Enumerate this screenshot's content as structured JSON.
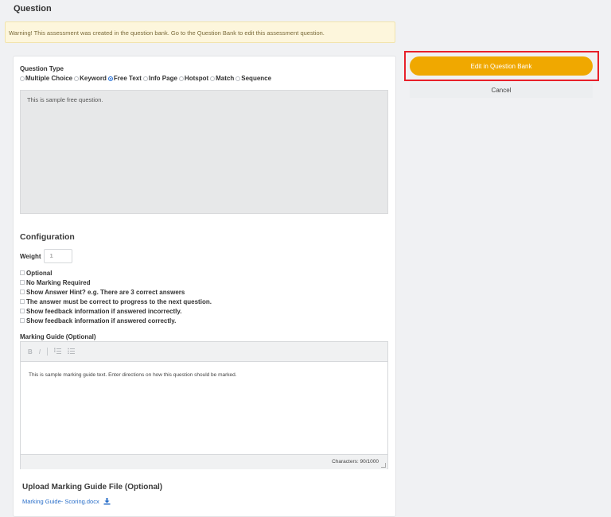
{
  "page": {
    "title": "Question"
  },
  "warning": {
    "text": "Warning! This assessment was created in the question bank. Go to the Question Bank to edit this assessment question."
  },
  "question_type": {
    "label": "Question Type",
    "options": [
      "Multiple Choice",
      "Keyword",
      "Free Text",
      "Info Page",
      "Hotspot",
      "Match",
      "Sequence"
    ],
    "selected": "Free Text"
  },
  "question_text": "This is sample free question.",
  "configuration": {
    "title": "Configuration",
    "weight_label": "Weight",
    "weight_value": "1",
    "checkboxes": [
      "Optional",
      "No Marking Required",
      "Show Answer Hint? e.g. There are 3 correct answers",
      "The answer must be correct to progress to the next question.",
      "Show feedback information if answered incorrectly.",
      "Show feedback information if answered correctly."
    ]
  },
  "marking_guide": {
    "label": "Marking Guide (Optional)",
    "text": "This is sample marking guide text. Enter directions on how this question should be marked.",
    "char_count": "Characters: 90/1000",
    "toolbar": {
      "bold": "B",
      "italic": "I"
    }
  },
  "upload": {
    "title": "Upload Marking Guide File (Optional)",
    "file_name": "Marking Guide- Scoring.docx"
  },
  "actions": {
    "edit_label": "Edit in Question Bank",
    "cancel_label": "Cancel"
  },
  "colors": {
    "accent": "#f0a800",
    "highlight": "#e8202a",
    "link": "#2a6fc9"
  }
}
